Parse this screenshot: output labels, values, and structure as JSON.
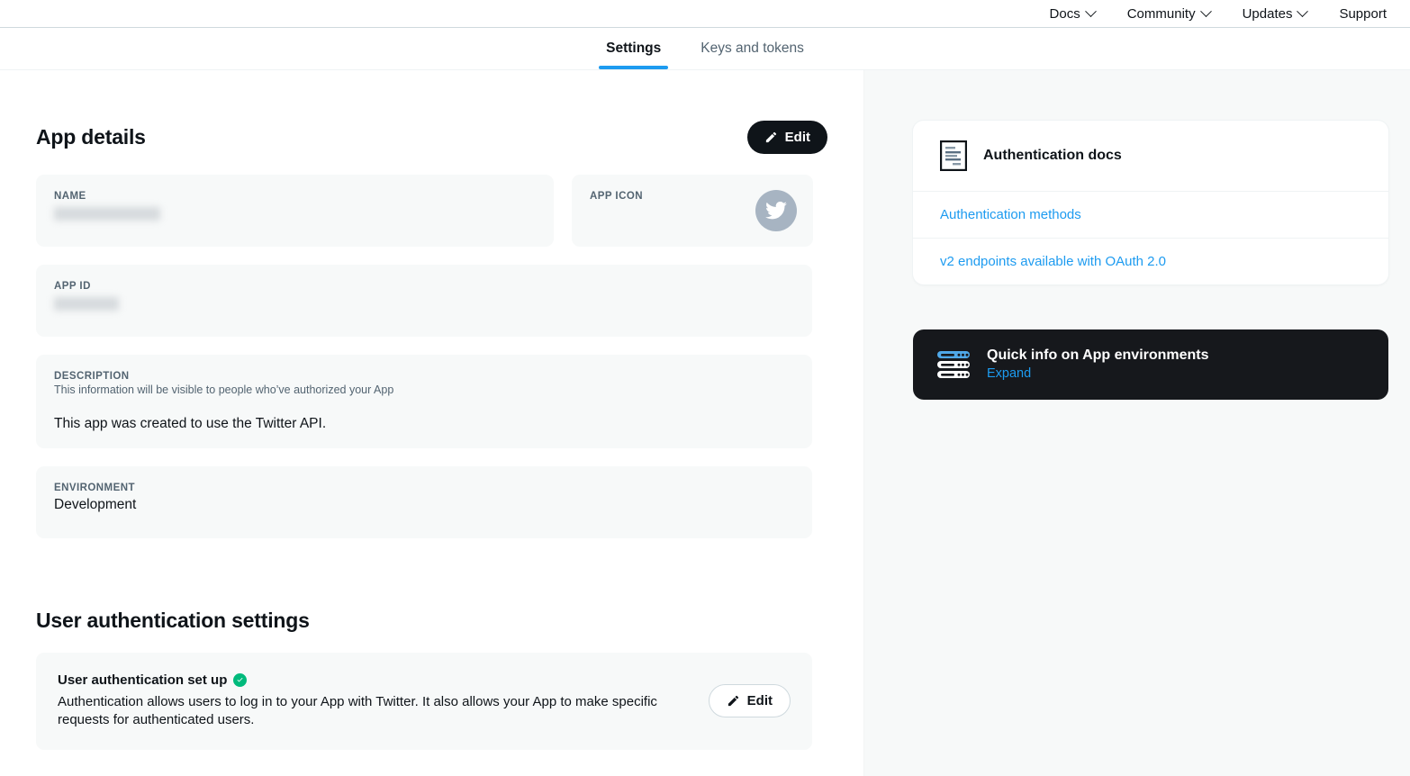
{
  "topnav": {
    "items": [
      {
        "label": "Docs",
        "has_chevron": true,
        "icon": "chevron-down-icon"
      },
      {
        "label": "Community",
        "has_chevron": true,
        "icon": "chevron-down-icon"
      },
      {
        "label": "Updates",
        "has_chevron": true,
        "icon": "chevron-down-icon"
      },
      {
        "label": "Support",
        "has_chevron": false
      }
    ]
  },
  "tabs": [
    {
      "label": "Settings",
      "active": true
    },
    {
      "label": "Keys and tokens",
      "active": false
    }
  ],
  "app_details": {
    "title": "App details",
    "edit_label": "Edit",
    "edit_icon": "pencil-icon",
    "name": {
      "label": "NAME",
      "value": "",
      "redacted": true
    },
    "app_icon": {
      "label": "APP ICON",
      "icon": "twitter-bird-icon"
    },
    "app_id": {
      "label": "APP ID",
      "value": "",
      "redacted": true
    },
    "description": {
      "label": "DESCRIPTION",
      "sublabel": "This information will be visible to people who’ve authorized your App",
      "value": "This app was created to use the Twitter API."
    },
    "environment": {
      "label": "ENVIRONMENT",
      "value": "Development"
    }
  },
  "user_auth": {
    "title": "User authentication settings",
    "status_title": "User authentication set up",
    "status_icon": "check-circle-icon",
    "description": "Authentication allows users to log in to your App with Twitter. It also allows your App to make specific requests for authenticated users.",
    "edit_label": "Edit",
    "edit_icon": "pencil-icon"
  },
  "sidebar": {
    "docs_card": {
      "icon": "document-icon",
      "title": "Authentication docs",
      "links": [
        {
          "label": "Authentication methods"
        },
        {
          "label": "v2 endpoints available with OAuth 2.0"
        }
      ]
    },
    "quick_info": {
      "icon": "server-stack-icon",
      "title": "Quick info on App environments",
      "expand_label": "Expand"
    }
  },
  "colors": {
    "accent_blue": "#1D9BF0",
    "dark": "#0F1419",
    "card_bg": "#F7F9F9",
    "success_green": "#00BA7C",
    "muted_text": "#536471",
    "app_icon_bg": "#A7B4C2"
  }
}
